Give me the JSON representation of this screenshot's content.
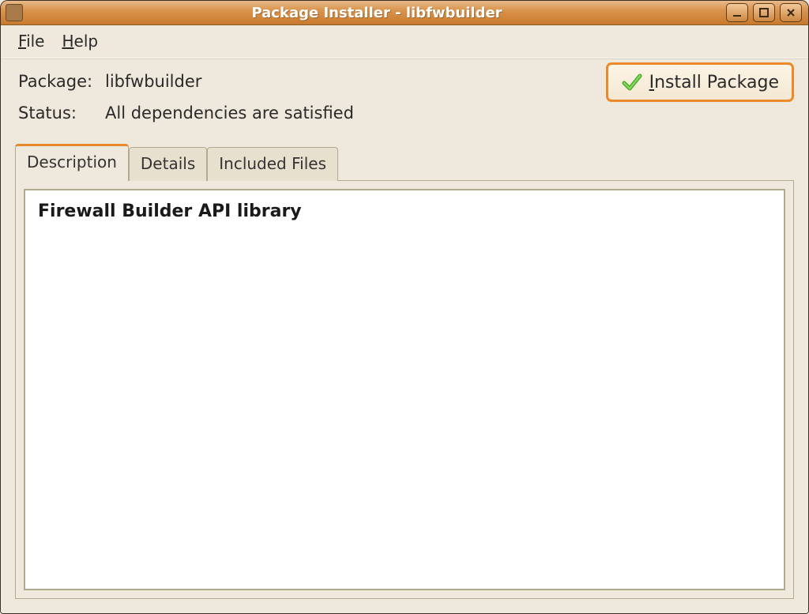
{
  "window": {
    "title": "Package Installer - libfwbuilder"
  },
  "menu": {
    "file": "File",
    "help": "Help"
  },
  "info": {
    "package_label": "Package:",
    "package_value": "libfwbuilder",
    "status_label": "Status:",
    "status_value": "All dependencies are satisfied"
  },
  "install_button": {
    "label": "Install Package"
  },
  "tabs": {
    "description": "Description",
    "details": "Details",
    "included_files": "Included Files"
  },
  "description_text": "Firewall Builder API library"
}
